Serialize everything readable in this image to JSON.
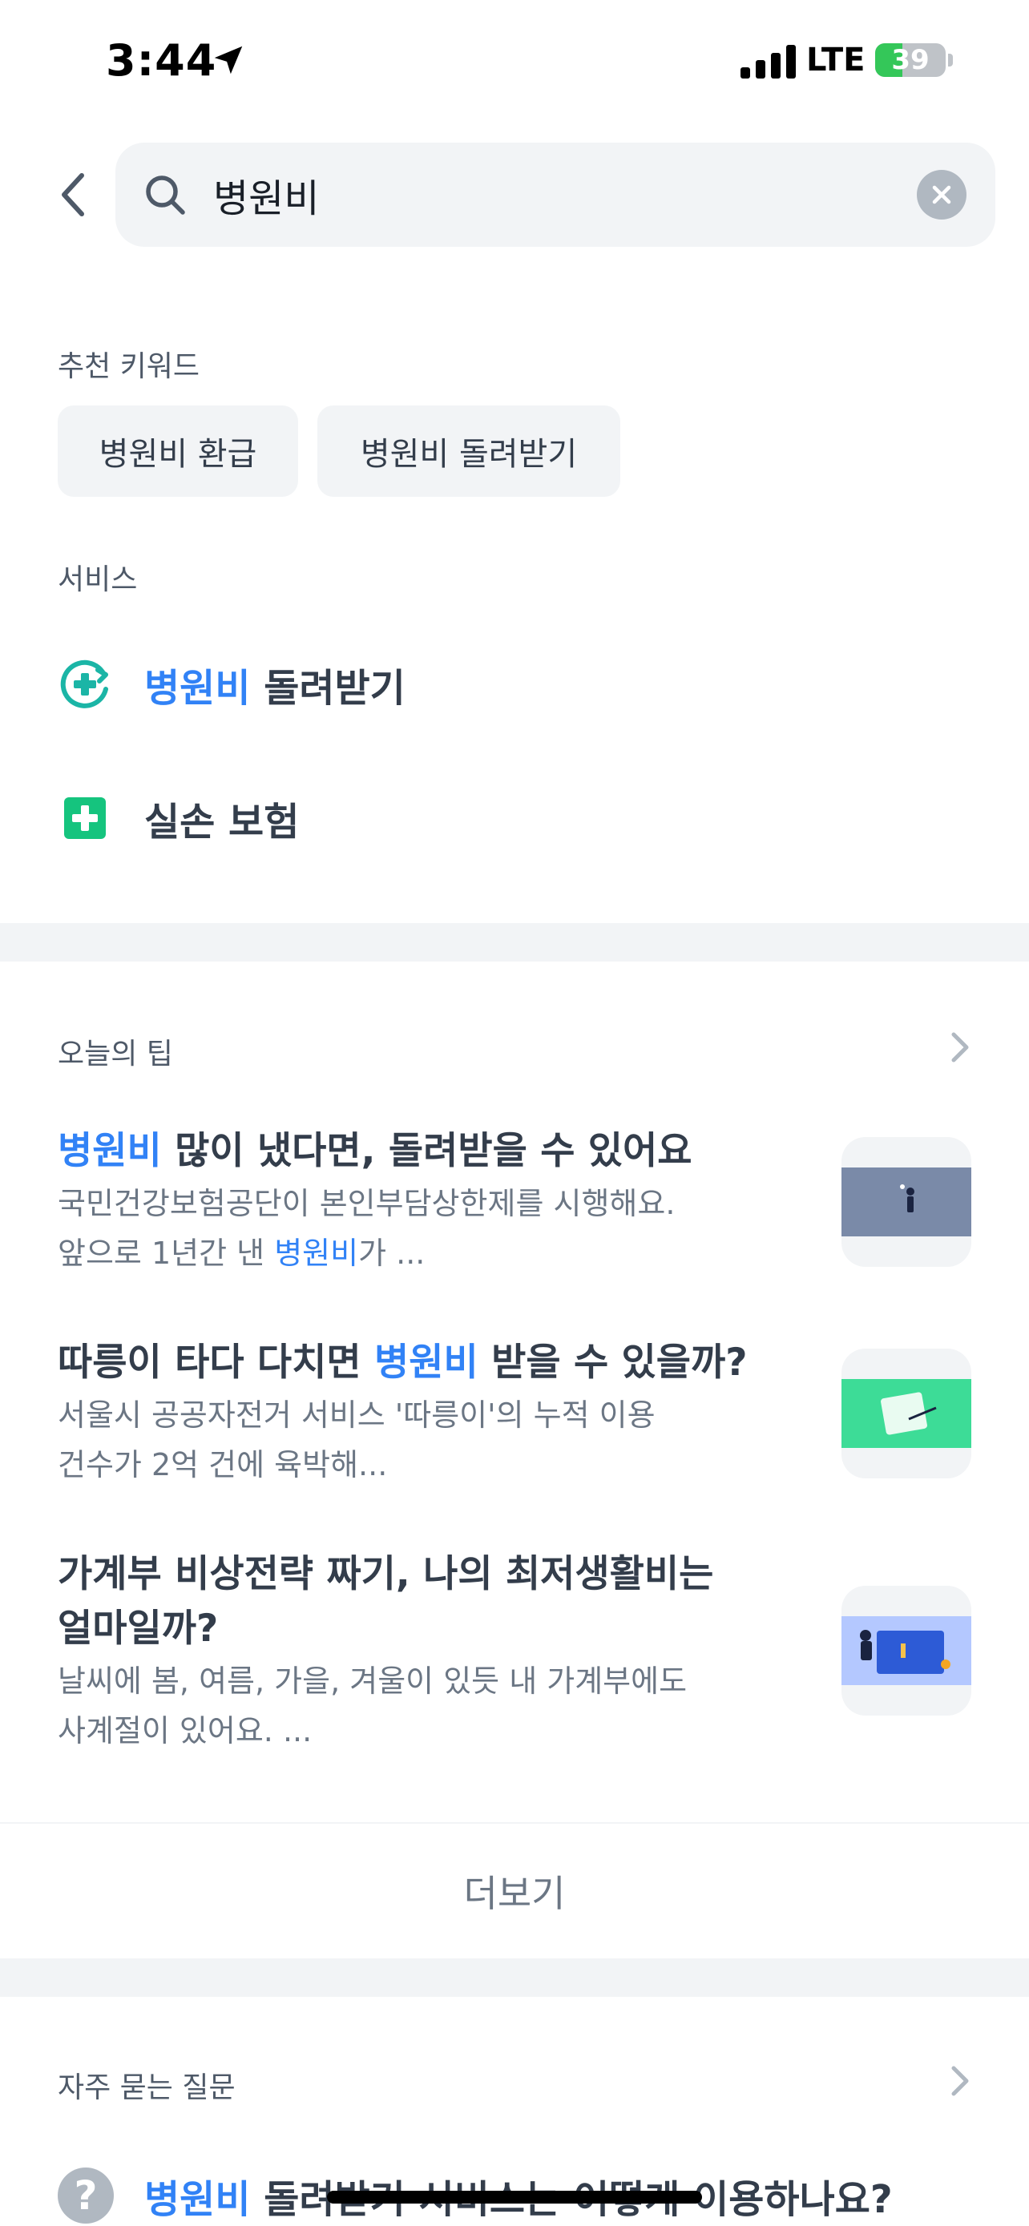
{
  "status_bar": {
    "time": "3:44",
    "network": "LTE",
    "battery_percent": "39",
    "battery_level": 0.39,
    "battery_color": "#34c759",
    "icons": [
      "location-arrow-icon",
      "signal-bars-icon",
      "battery-charging-icon"
    ]
  },
  "search": {
    "query": "병원비",
    "icons": {
      "back": "chevron-left-icon",
      "search": "search-icon",
      "clear": "clear-circle-icon"
    }
  },
  "recommended": {
    "label": "추천 키워드",
    "chips": [
      "병원비 환급",
      "병원비 돌려받기"
    ]
  },
  "services": {
    "label": "서비스",
    "items": [
      {
        "highlight": "병원비",
        "rest": " 돌려받기",
        "icon": "refund-cross-icon",
        "icon_color": "#1bb5a6"
      },
      {
        "highlight": "",
        "rest": "실손 보험",
        "icon": "green-cross-icon",
        "icon_color": "#15c47e"
      }
    ]
  },
  "tips": {
    "label": "오늘의 팁",
    "items": [
      {
        "title_before": "",
        "title_highlight": "병원비",
        "title_after": " 많이 냈다면, 돌려받을 수 있어요",
        "desc_line1": "국민건강보험공단이 본인부담상한제를 시행해요.",
        "desc_line2_before": "앞으로 1년간 낸 ",
        "desc_line2_highlight": "병원비",
        "desc_line2_after": "가 ...",
        "thumb_color": "#7a8aa8"
      },
      {
        "title_before": "따릉이 타다 다치면 ",
        "title_highlight": "병원비",
        "title_after": " 받을 수 있을까?",
        "desc_line1": "서울시 공공자전거 서비스 '따릉이'의 누적 이용",
        "desc_line2_before": "건수가 2억 건에 육박해...",
        "desc_line2_highlight": "",
        "desc_line2_after": "",
        "thumb_color": "#3ddc97"
      },
      {
        "title_line1": "가계부 비상전략 짜기, 나의 최저생활비는",
        "title_line2": "얼마일까?",
        "desc_line1": "날씨에 봄, 여름, 가을, 겨울이 있듯 내 가계부에도",
        "desc_line2": "사계절이 있어요. ...",
        "thumb_color": "#b4c8ff"
      }
    ],
    "more_label": "더보기"
  },
  "faq": {
    "label": "자주 묻는 질문",
    "item_highlight": "병원비",
    "item_rest": " 돌려받기 서비스는 어떻게 이용하나요?"
  },
  "colors": {
    "highlight": "#3182f6",
    "chip_bg": "#f2f4f6",
    "divider": "#f2f4f6"
  }
}
